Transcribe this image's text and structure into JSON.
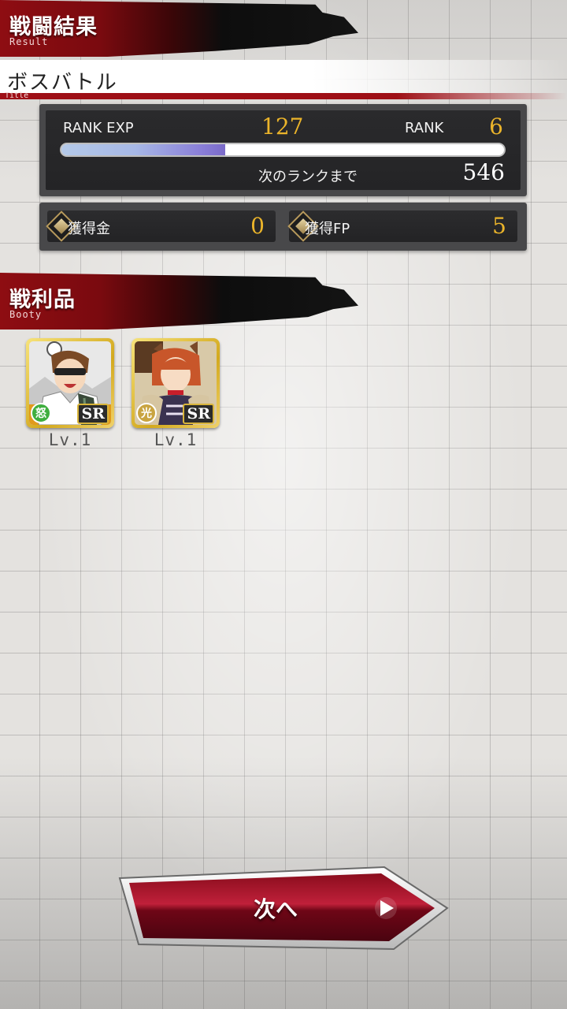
{
  "header": {
    "title_jp": "戦闘結果",
    "title_en": "Result"
  },
  "title_bar": {
    "name": "ボスバトル",
    "sub": "Title"
  },
  "rank_panel": {
    "rank_exp_label": "RANK EXP",
    "rank_exp_value": "127",
    "rank_label": "RANK",
    "rank_value": "6",
    "next_rank_label": "次のランクまで",
    "next_rank_value": "546",
    "exp_progress": 0.37
  },
  "rewards": {
    "money_label": "獲得金",
    "money_value": "0",
    "fp_label": "獲得FP",
    "fp_value": "5"
  },
  "booty_header": {
    "title_jp": "戦利品",
    "title_en": "Booty"
  },
  "booty": [
    {
      "attribute": "怒",
      "attribute_color": "#3fae3f",
      "rarity": "SR",
      "level": "Lv.1"
    },
    {
      "attribute": "光",
      "attribute_color": "#c9a441",
      "rarity": "SR",
      "level": "Lv.1"
    }
  ],
  "next_button": {
    "label": "次へ"
  },
  "colors": {
    "accent_red": "#9e0f16",
    "gold": "#ebb42a"
  }
}
